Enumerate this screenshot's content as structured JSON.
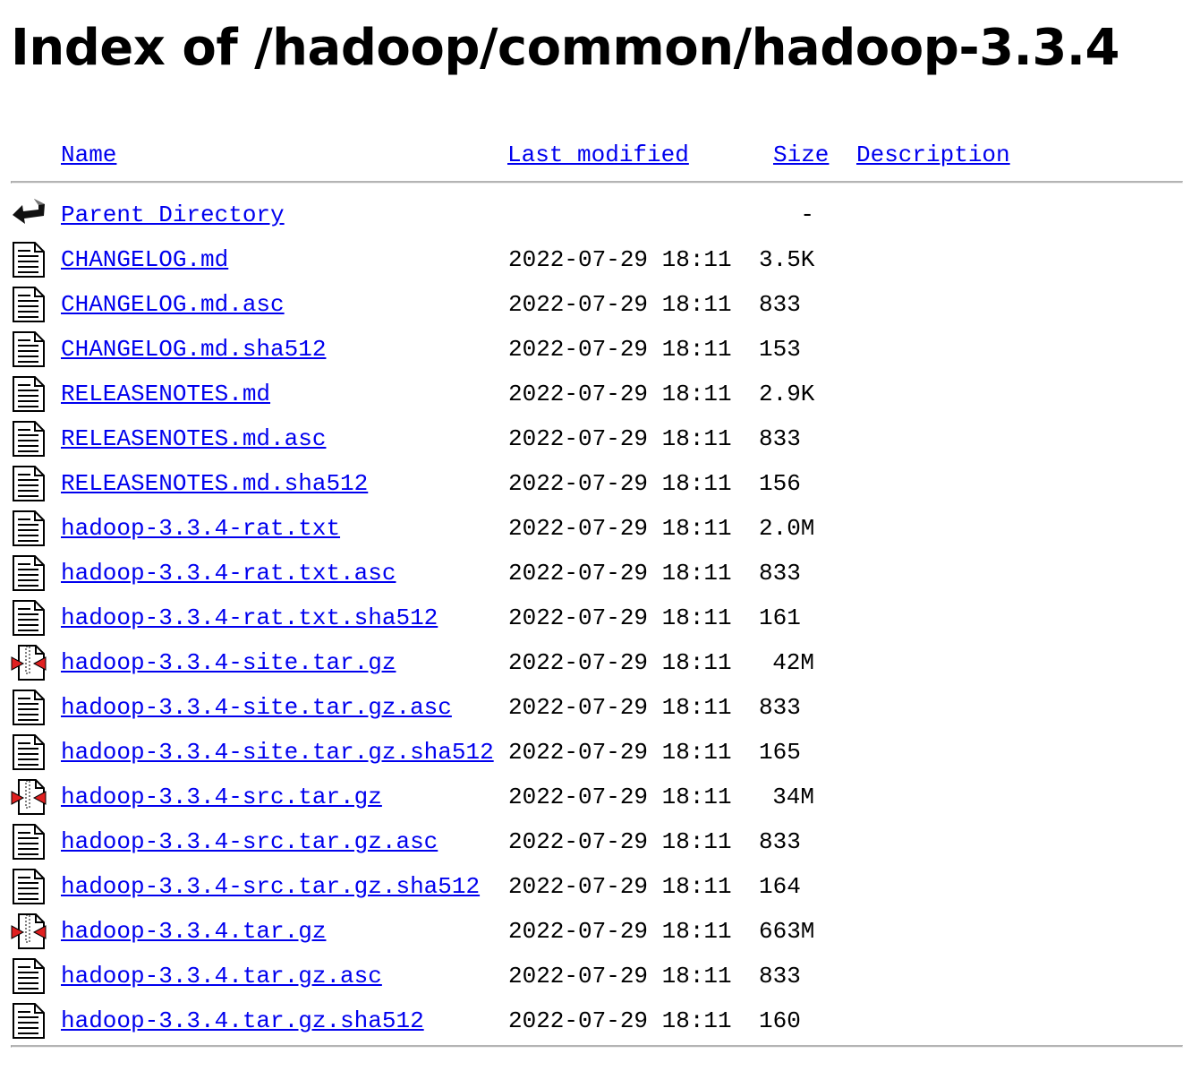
{
  "page": {
    "title": "Index of /hadoop/common/hadoop-3.3.4"
  },
  "columns": {
    "name": "Name",
    "last_modified": "Last modified",
    "size": "Size",
    "description": "Description"
  },
  "parent": {
    "label": "Parent Directory",
    "size": "-",
    "icon": "back-icon"
  },
  "files": [
    {
      "name": "CHANGELOG.md",
      "modified": "2022-07-29 18:11",
      "size": "3.5K",
      "icon": "text-file-icon"
    },
    {
      "name": "CHANGELOG.md.asc",
      "modified": "2022-07-29 18:11",
      "size": "833",
      "icon": "text-file-icon"
    },
    {
      "name": "CHANGELOG.md.sha512",
      "modified": "2022-07-29 18:11",
      "size": "153",
      "icon": "text-file-icon"
    },
    {
      "name": "RELEASENOTES.md",
      "modified": "2022-07-29 18:11",
      "size": "2.9K",
      "icon": "text-file-icon"
    },
    {
      "name": "RELEASENOTES.md.asc",
      "modified": "2022-07-29 18:11",
      "size": "833",
      "icon": "text-file-icon"
    },
    {
      "name": "RELEASENOTES.md.sha512",
      "modified": "2022-07-29 18:11",
      "size": "156",
      "icon": "text-file-icon"
    },
    {
      "name": "hadoop-3.3.4-rat.txt",
      "modified": "2022-07-29 18:11",
      "size": "2.0M",
      "icon": "text-file-icon"
    },
    {
      "name": "hadoop-3.3.4-rat.txt.asc",
      "modified": "2022-07-29 18:11",
      "size": "833",
      "icon": "text-file-icon"
    },
    {
      "name": "hadoop-3.3.4-rat.txt.sha512",
      "modified": "2022-07-29 18:11",
      "size": "161",
      "icon": "text-file-icon"
    },
    {
      "name": "hadoop-3.3.4-site.tar.gz",
      "modified": "2022-07-29 18:11",
      "size": "42M",
      "icon": "compressed-file-icon"
    },
    {
      "name": "hadoop-3.3.4-site.tar.gz.asc",
      "modified": "2022-07-29 18:11",
      "size": "833",
      "icon": "text-file-icon"
    },
    {
      "name": "hadoop-3.3.4-site.tar.gz.sha512",
      "modified": "2022-07-29 18:11",
      "size": "165",
      "icon": "text-file-icon"
    },
    {
      "name": "hadoop-3.3.4-src.tar.gz",
      "modified": "2022-07-29 18:11",
      "size": "34M",
      "icon": "compressed-file-icon"
    },
    {
      "name": "hadoop-3.3.4-src.tar.gz.asc",
      "modified": "2022-07-29 18:11",
      "size": "833",
      "icon": "text-file-icon"
    },
    {
      "name": "hadoop-3.3.4-src.tar.gz.sha512",
      "modified": "2022-07-29 18:11",
      "size": "164",
      "icon": "text-file-icon"
    },
    {
      "name": "hadoop-3.3.4.tar.gz",
      "modified": "2022-07-29 18:11",
      "size": "663M",
      "icon": "compressed-file-icon"
    },
    {
      "name": "hadoop-3.3.4.tar.gz.asc",
      "modified": "2022-07-29 18:11",
      "size": "833",
      "icon": "text-file-icon"
    },
    {
      "name": "hadoop-3.3.4.tar.gz.sha512",
      "modified": "2022-07-29 18:11",
      "size": "160",
      "icon": "text-file-icon"
    }
  ],
  "colors": {
    "link": "#0000ee",
    "rule": "#b4b4b4",
    "compressed_accent": "#e02020"
  }
}
